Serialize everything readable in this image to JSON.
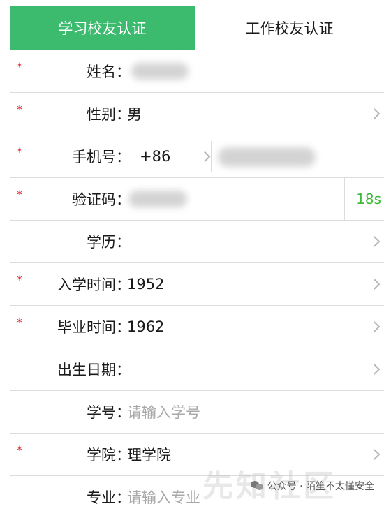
{
  "tabs": {
    "active_label": "学习校友认证",
    "inactive_label": "工作校友认证"
  },
  "colon": "：",
  "rows": {
    "name": {
      "label": "姓名",
      "required": "*"
    },
    "gender": {
      "label": "性别",
      "required": "*",
      "value": "男"
    },
    "phone": {
      "label": "手机号",
      "required": "*",
      "country_code": "+86"
    },
    "code": {
      "label": "验证码",
      "required": "*",
      "countdown": "18s"
    },
    "education": {
      "label": "学历"
    },
    "enroll": {
      "label": "入学时间",
      "required": "*",
      "value": "1952"
    },
    "graduate": {
      "label": "毕业时间",
      "required": "*",
      "value": "1962"
    },
    "birth": {
      "label": "出生日期"
    },
    "student_id": {
      "label": "学号",
      "placeholder": "请输入学号"
    },
    "college": {
      "label": "学院",
      "required": "*",
      "value": "理学院"
    },
    "major": {
      "label": "专业",
      "placeholder": "请输入专业"
    }
  },
  "watermark": {
    "logo": "先知社区",
    "text": "公众号 · 陌笙不太懂安全"
  },
  "colors": {
    "accent": "#3cba6e",
    "countdown": "#3cba3c",
    "required": "#e02020"
  }
}
